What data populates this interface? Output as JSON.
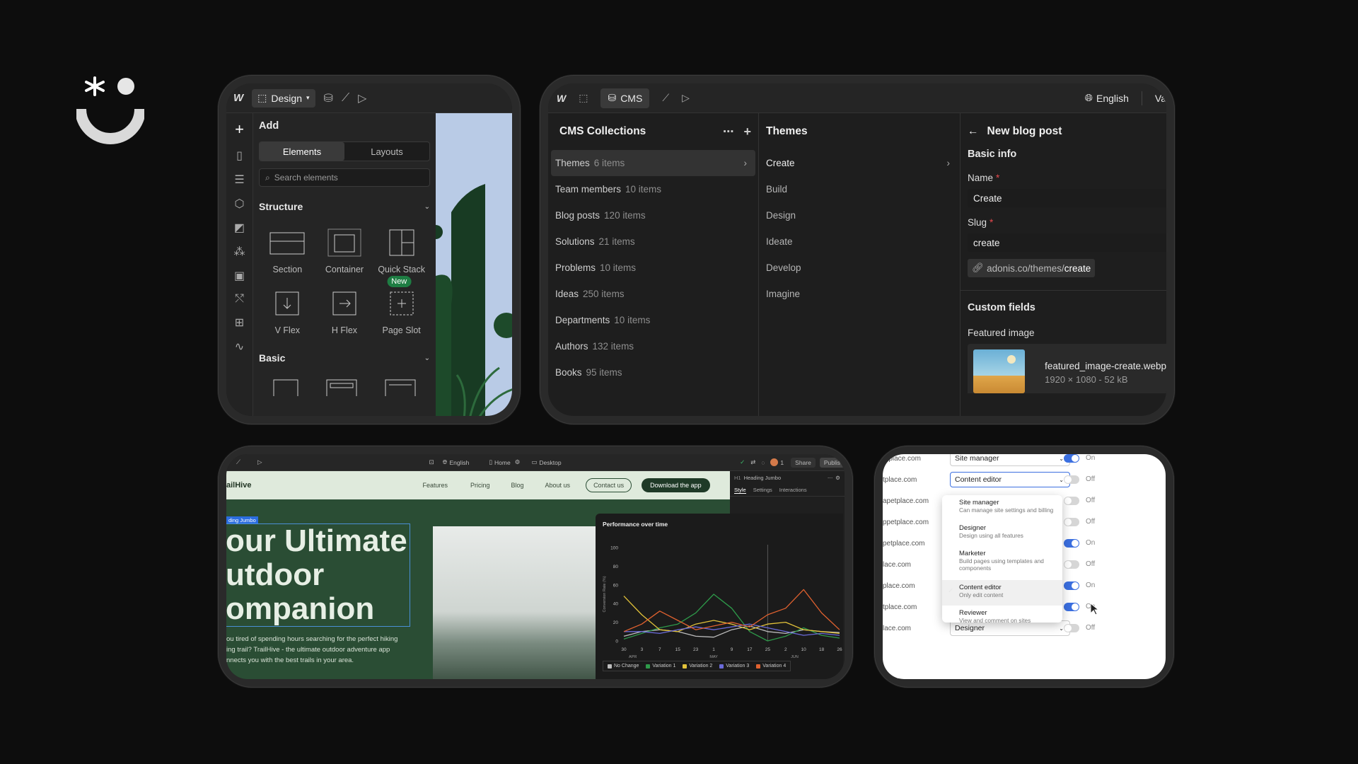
{
  "brand_logo": "asterisk-smile-logo",
  "designer": {
    "toolbar": {
      "mode_label": "Design"
    },
    "panel_title": "Add",
    "tabs": [
      "Elements",
      "Layouts"
    ],
    "search_placeholder": "Search elements",
    "structure": {
      "heading": "Structure",
      "items": [
        {
          "label": "Section",
          "icon": "section-icon"
        },
        {
          "label": "Container",
          "icon": "container-icon"
        },
        {
          "label": "Quick Stack",
          "icon": "quick-stack-icon"
        },
        {
          "label": "V Flex",
          "icon": "vflex-icon"
        },
        {
          "label": "H Flex",
          "icon": "hflex-icon"
        },
        {
          "label": "Page Slot",
          "icon": "page-slot-icon",
          "badge": "New"
        }
      ]
    },
    "basic": {
      "heading": "Basic"
    }
  },
  "cms": {
    "toolbar": {
      "cms_label": "CMS",
      "language": "English",
      "user_initials": "Va"
    },
    "collections": {
      "title": "CMS Collections",
      "items": [
        {
          "name": "Themes",
          "count": "6 items"
        },
        {
          "name": "Team members",
          "count": "10 items"
        },
        {
          "name": "Blog posts",
          "count": "120 items"
        },
        {
          "name": "Solutions",
          "count": "21 items"
        },
        {
          "name": "Problems",
          "count": "10 items"
        },
        {
          "name": "Ideas",
          "count": "250 items"
        },
        {
          "name": "Departments",
          "count": "10 items"
        },
        {
          "name": "Authors",
          "count": "132 items"
        },
        {
          "name": "Books",
          "count": "95 items"
        }
      ]
    },
    "themes": {
      "title": "Themes",
      "items": [
        "Create",
        "Build",
        "Design",
        "Ideate",
        "Develop",
        "Imagine"
      ]
    },
    "post": {
      "title": "New blog post",
      "basic_info": "Basic info",
      "name_label": "Name",
      "name_value": "Create",
      "slug_label": "Slug",
      "slug_value": "create",
      "url_prefix": "adonis.co/themes/",
      "url_slug": "create",
      "custom_fields": "Custom fields",
      "featured_image_label": "Featured image",
      "file_name": "featured_image-create.webp",
      "file_meta": "1920 × 1080 - 52 kB"
    }
  },
  "editor": {
    "toolbar": {
      "language": "English",
      "page": "Home",
      "breakpoint": "Desktop",
      "user_count": "1",
      "share": "Share",
      "publish": "Publis"
    },
    "site": {
      "logo": "ailHive",
      "nav": [
        "Features",
        "Pricing",
        "Blog",
        "About us"
      ],
      "contact": "Contact us",
      "download": "Download the app",
      "selection_label": "ding Jumbo",
      "hero_lines": [
        "our Ultimate",
        "utdoor",
        "ompanion"
      ],
      "body_lines": [
        "ou tired of spending hours searching for the perfect hiking",
        "ing trail? TrailHive - the ultimate outdoor adventure app",
        "nnects you with the best trails in your area."
      ]
    },
    "style_panel": {
      "element": "Heading Jumbo",
      "element_tag": "H1",
      "tabs": [
        "Style",
        "Settings",
        "Interactions"
      ]
    }
  },
  "chart_data": {
    "type": "line",
    "title": "Performance over time",
    "ylabel": "Conversion Rate (%)",
    "ylim": [
      0,
      100
    ],
    "yticks": [
      0,
      20,
      40,
      60,
      80,
      100
    ],
    "x": [
      "30",
      "3",
      "7",
      "15",
      "23",
      "1",
      "9",
      "17",
      "25",
      "2",
      "10",
      "18",
      "26"
    ],
    "month_labels": [
      "APR",
      "MAY",
      "JUN"
    ],
    "series": [
      {
        "name": "No Change",
        "color": "#bdbdbd",
        "values": [
          5,
          10,
          12,
          10,
          5,
          4,
          12,
          16,
          10,
          8,
          12,
          10,
          9
        ]
      },
      {
        "name": "Variation 1",
        "color": "#2e9a4a",
        "values": [
          2,
          8,
          14,
          18,
          30,
          50,
          35,
          10,
          0,
          5,
          14,
          6,
          3
        ]
      },
      {
        "name": "Variation 2",
        "color": "#e2c23a",
        "values": [
          48,
          28,
          12,
          10,
          18,
          22,
          18,
          12,
          18,
          20,
          12,
          10,
          8
        ]
      },
      {
        "name": "Variation 3",
        "color": "#6a6ad8",
        "values": [
          10,
          10,
          8,
          12,
          15,
          12,
          15,
          18,
          14,
          10,
          6,
          8,
          6
        ]
      },
      {
        "name": "Variation 4",
        "color": "#e0612f",
        "values": [
          10,
          18,
          32,
          22,
          12,
          16,
          20,
          15,
          28,
          35,
          55,
          30,
          12
        ]
      }
    ]
  },
  "permissions": {
    "top_role": "Site manager",
    "current_role": "Content editor",
    "bottom_role": "Designer",
    "rows": [
      {
        "site": "etplace.com",
        "state": "On",
        "on": true
      },
      {
        "site": "tplace.com",
        "state": "Off",
        "on": false
      },
      {
        "site": "apetplace.com",
        "state": "Off",
        "on": false
      },
      {
        "site": "ppetplace.com",
        "state": "Off",
        "on": false
      },
      {
        "site": "petplace.com",
        "state": "On",
        "on": true
      },
      {
        "site": "lace.com",
        "state": "Off",
        "on": false
      },
      {
        "site": "place.com",
        "state": "On",
        "on": true
      },
      {
        "site": "tplace.com",
        "state": "On",
        "on": true
      },
      {
        "site": "lace.com",
        "state": "Off",
        "on": false
      }
    ],
    "dropdown": [
      {
        "title": "Site manager",
        "desc": "Can manage site settings and billing"
      },
      {
        "title": "Designer",
        "desc": "Design using all features"
      },
      {
        "title": "Marketer",
        "desc": "Build pages using templates and components"
      },
      {
        "title": "Content editor",
        "desc": "Only edit content",
        "checked": true
      },
      {
        "title": "Reviewer",
        "desc": "View and comment on sites"
      }
    ]
  },
  "colors": {
    "background": "#0d0d0d",
    "toggle_on": "#3b6fe0",
    "new_badge": "#1e7d43",
    "required": "#e5484d",
    "site_green": "#2a4d34"
  }
}
